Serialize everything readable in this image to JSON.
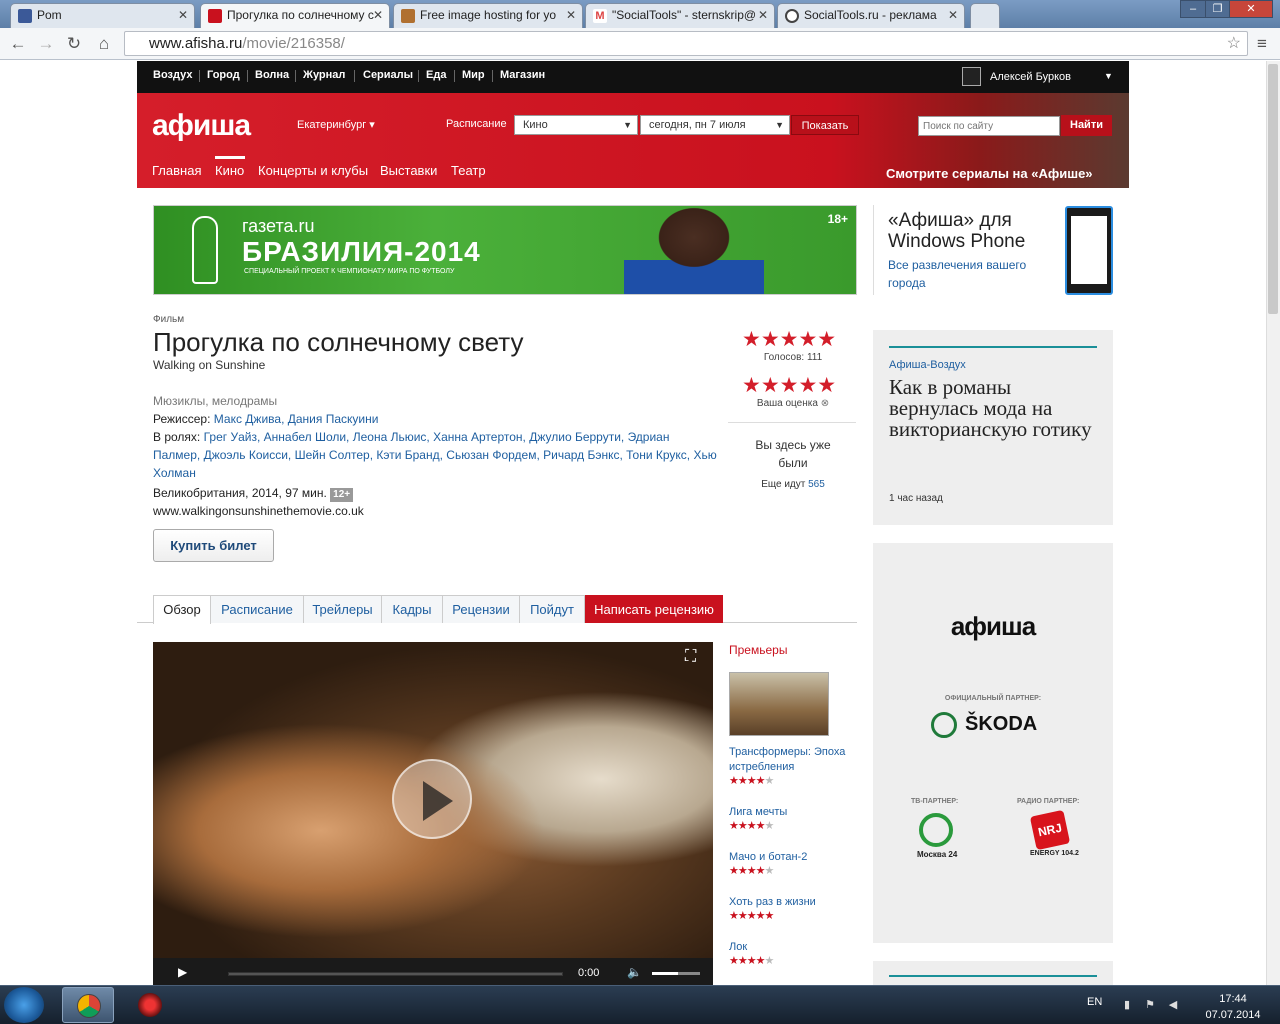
{
  "browser": {
    "tabs": [
      {
        "title": "Pom",
        "favicon_color": "#3b5998",
        "active": false
      },
      {
        "title": "Прогулка по солнечному с",
        "favicon_color": "#c9111e",
        "active": true
      },
      {
        "title": "Free image hosting for yo",
        "favicon_color": "#b07030",
        "active": false
      },
      {
        "title": "\"SocialTools\" - sternskrip@",
        "favicon_color": "#d44",
        "active": false
      },
      {
        "title": "SocialTools.ru - реклама",
        "favicon_color": "#444",
        "active": false
      }
    ],
    "url_host": "www.afisha.ru",
    "url_path": "/movie/216358/",
    "window_buttons": [
      "–",
      "❐",
      "✕"
    ],
    "nav_icons": [
      "arrow-left-icon",
      "arrow-right-icon",
      "reload-icon",
      "home-icon"
    ],
    "menu_icon": "≡",
    "star_icon": "☆"
  },
  "topnav": {
    "items": [
      "Воздух",
      "Город",
      "Волна",
      "Журнал",
      "Сериалы",
      "Еда",
      "Мир",
      "Магазин"
    ],
    "user": "Алексей Бурков",
    "caret": "▼"
  },
  "header": {
    "logo": "афиша",
    "city": "Екатеринбург ▾",
    "schedule_label": "Расписание",
    "select_type": "Кино",
    "select_date": "сегодня, пн 7 июля",
    "show_button": "Показать",
    "search_placeholder": "Поиск по сайту",
    "find_button": "Найти",
    "menu": [
      "Главная",
      "Кино",
      "Концерты и клубы",
      "Выставки",
      "Театр"
    ],
    "promo": "Смотрите сериалы на «Афише»"
  },
  "banner": {
    "site": "газета.ru",
    "headline": "БРАЗИЛИЯ-2014",
    "sub": "СПЕЦИАЛЬНЫЙ ПРОЕКТ К ЧЕМПИОНАТУ МИРА ПО ФУТБОЛУ",
    "age": "18+"
  },
  "wp_promo": {
    "title": "«Афиша» для Windows Phone",
    "subtitle": "Все развлечения вашего города"
  },
  "film": {
    "kind": "Фильм",
    "title": "Прогулка по солнечному свету",
    "original_title": "Walking on Sunshine",
    "genre": "Мюзиклы, мелодрамы",
    "director_label": "Режиссер:",
    "directors": "Макс Джива, Дания Паскуини",
    "cast_label": "В ролях:",
    "cast": "Грег Уайз, Аннабел Шоли, Леона Льюис, Ханна Артертон, Джулио Беррути, Эдриан Палмер, Джоэль Коисси, Шейн Солтер, Кэти Бранд, Сьюзан Фордем, Ричард Бэнкс, Тони Крукс, Хью Холман",
    "country_year": "Великобритания, 2014, 97 мин.",
    "age": "12+",
    "site": "www.walkingonsunshinethemovie.co.uk",
    "buy_button": "Купить билет"
  },
  "rating": {
    "stars": "★★★★★",
    "average": 4.5,
    "votes_label": "Голосов: 111",
    "my_rating_label": "Ваша оценка",
    "clear_icon": "⊗",
    "been_label": "Вы здесь уже были",
    "going_label": "Еще идут",
    "going_count": "565"
  },
  "page_tabs": [
    "Обзор",
    "Расписание",
    "Трейлеры",
    "Кадры",
    "Рецензии",
    "Пойдут",
    "Написать рецензию"
  ],
  "video": {
    "time": "0:00",
    "progress": 0,
    "volume": 0.55,
    "play_icon": "▶",
    "fullscreen_icon": "⛶",
    "volume_icon": "🔈"
  },
  "premieres": {
    "heading": "Премьеры",
    "items": [
      {
        "title": "Трансформеры: Эпоха истребления",
        "rating": 3.5
      },
      {
        "title": "Лига мечты",
        "rating": 4
      },
      {
        "title": "Мачо и ботан-2",
        "rating": 4
      },
      {
        "title": "Хоть раз в жизни",
        "rating": 4.5
      },
      {
        "title": "Лок",
        "rating": 4
      }
    ]
  },
  "news": {
    "category": "Афиша-Воздух",
    "headline": "Как в романы вернулась мода на викторианскую готику",
    "time": "1 час назад"
  },
  "partners": {
    "logo": "афиша",
    "official_label": "ОФИЦИАЛЬНЫЙ ПАРТНЕР:",
    "official": "ŠKODA",
    "tv_label": "ТВ-ПАРТНЕР:",
    "tv": "Москва 24",
    "radio_label": "РАДИО ПАРТНЕР:",
    "radio": "NRJ",
    "radio_sub": "ENERGY 104.2"
  },
  "taskbar": {
    "lang": "EN",
    "time": "17:44",
    "date": "07.07.2014"
  }
}
